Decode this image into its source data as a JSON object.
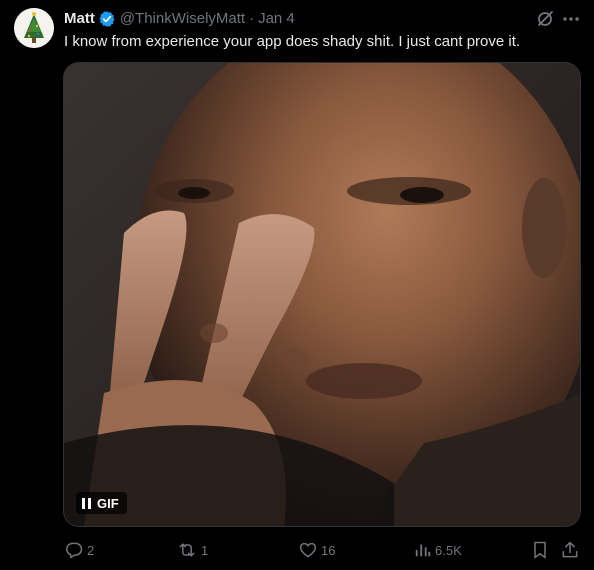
{
  "tweet": {
    "author_name": "Matt",
    "handle": "@ThinkWiselyMatt",
    "separator": "·",
    "date": "Jan 4",
    "text": "I know from experience your app does shady shit. I just cant prove it."
  },
  "media": {
    "badge_label": "GIF"
  },
  "actions": {
    "replies": "2",
    "reposts": "1",
    "likes": "16",
    "views": "6.5K"
  },
  "colors": {
    "background": "#000000",
    "text": "#e7e9ea",
    "muted": "#71767b",
    "verified": "#1d9bf0"
  },
  "icons": {
    "avatar": "christmas-tree-avatar",
    "verified": "verified-badge-icon",
    "grok": "grok-icon",
    "more": "more-icon",
    "pause": "pause-icon",
    "reply": "reply-icon",
    "repost": "repost-icon",
    "like": "like-icon",
    "views": "views-icon",
    "bookmark": "bookmark-icon",
    "share": "share-icon"
  }
}
